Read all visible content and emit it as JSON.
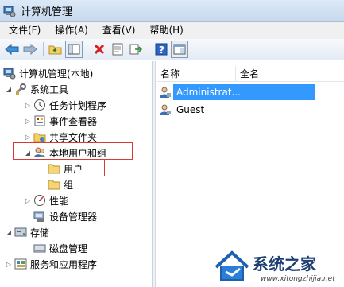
{
  "window": {
    "title": "计算机管理"
  },
  "menu": [
    "文件(F)",
    "操作(A)",
    "查看(V)",
    "帮助(H)"
  ],
  "toolbar": {
    "buttons": [
      "back-icon",
      "forward-icon",
      "up-folder-icon",
      "show-tree-icon",
      "delete-icon",
      "properties-icon",
      "export-icon",
      "help-icon",
      "view-icon"
    ]
  },
  "tree": {
    "root": "计算机管理(本地)",
    "system_tools": "系统工具",
    "task_scheduler": "任务计划程序",
    "event_viewer": "事件查看器",
    "shared_folders": "共享文件夹",
    "local_users_groups": "本地用户和组",
    "users": "用户",
    "groups": "组",
    "performance": "性能",
    "device_manager": "设备管理器",
    "storage": "存储",
    "disk_management": "磁盘管理",
    "services_apps": "服务和应用程序"
  },
  "list": {
    "columns": [
      "名称",
      "全名"
    ],
    "rows": [
      {
        "name": "Administrat...",
        "selected": true
      },
      {
        "name": "Guest",
        "selected": false
      }
    ]
  },
  "watermark": {
    "text": "系统之家",
    "url": "www.xitongzhijia.net"
  }
}
